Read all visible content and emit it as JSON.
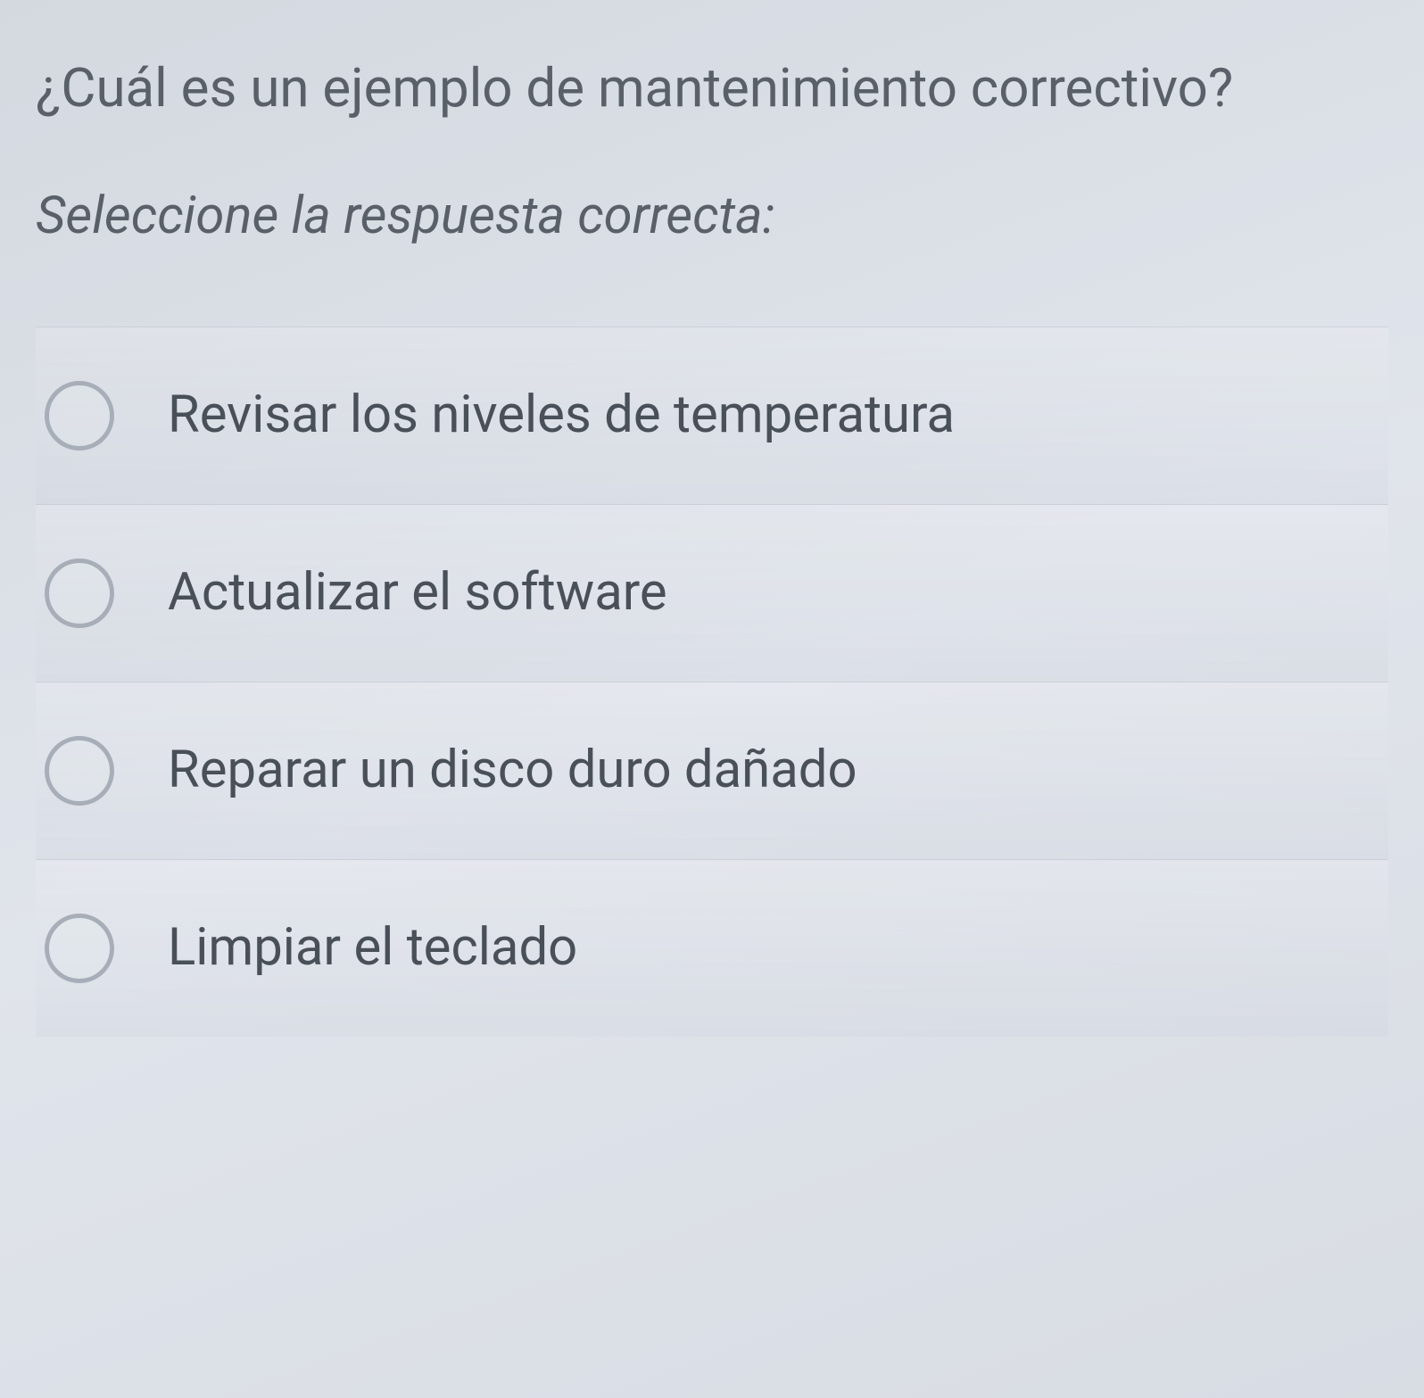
{
  "question": {
    "text": "¿Cuál es un ejemplo de mantenimiento correctivo?",
    "instruction": "Seleccione la respuesta correcta:"
  },
  "options": [
    {
      "label": "Revisar los niveles de temperatura"
    },
    {
      "label": "Actualizar el software"
    },
    {
      "label": "Reparar un disco duro dañado"
    },
    {
      "label": "Limpiar el teclado"
    }
  ]
}
